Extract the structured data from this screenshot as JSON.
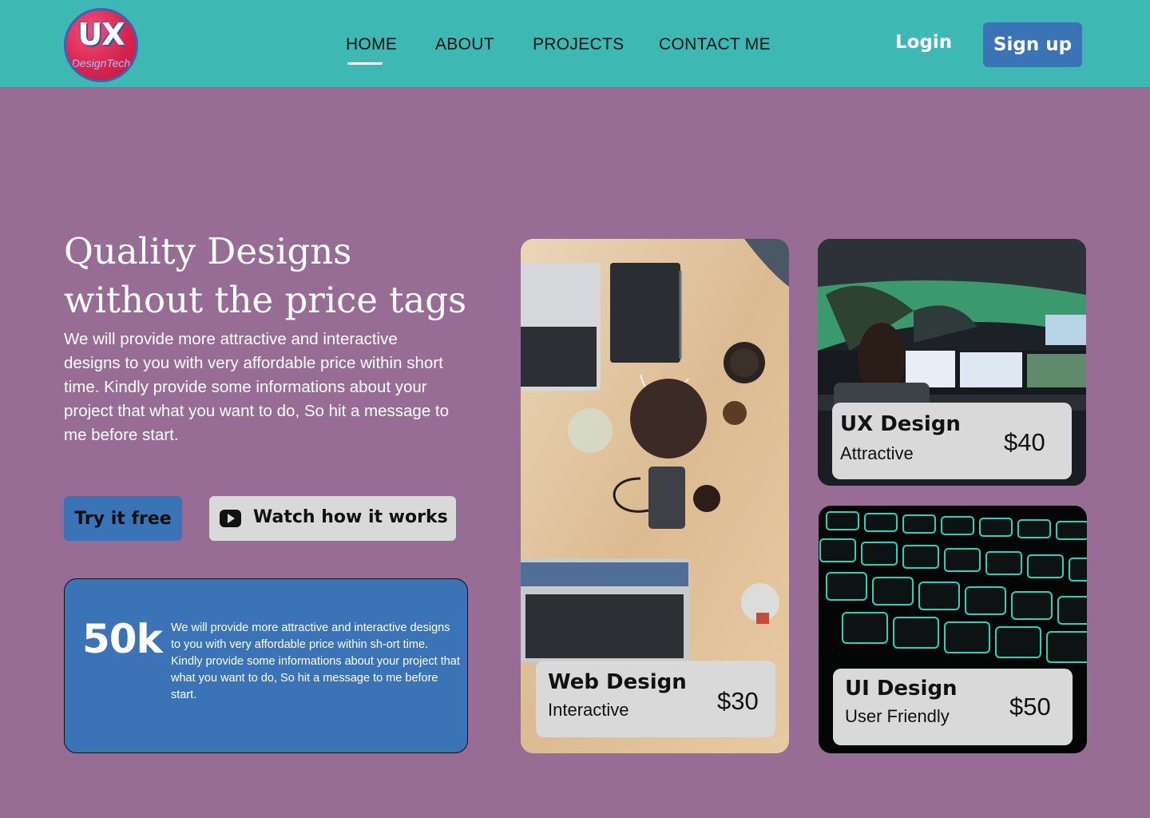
{
  "brand": {
    "logo_main": "UX",
    "logo_sub": "DesignTech"
  },
  "nav": {
    "items": [
      {
        "label": "HOME",
        "active": true
      },
      {
        "label": "ABOUT",
        "active": false
      },
      {
        "label": "PROJECTS",
        "active": false
      },
      {
        "label": "CONTACT ME",
        "active": false
      }
    ],
    "login_label": "Login",
    "signup_label": "Sign up"
  },
  "hero": {
    "title": "Quality Designs without the price tags",
    "description": "We will provide more attractive and interactive designs to you with very affordable price within short time. Kindly provide some informations about your project that what you want to do, So hit a message to me before start.",
    "try_label": "Try it free",
    "watch_label": "Watch how it works",
    "watch_icon": "play-icon"
  },
  "stat": {
    "number": "50k",
    "description": "We will provide more attractive and interactive designs to you with very affordable price within sh-ort time. Kindly provide some informations about your project that what you want to do, So hit a message to me before start."
  },
  "cards": [
    {
      "title": "Web Design",
      "subtitle": "Interactive",
      "price": "$30",
      "image": "desk-with-laptops-photo"
    },
    {
      "title": "UX Design",
      "subtitle": "Attractive",
      "price": "$40",
      "image": "control-room-monitors-photo"
    },
    {
      "title": "UI Design",
      "subtitle": "User Friendly",
      "price": "$50",
      "image": "glowing-keyboard-photo"
    }
  ],
  "colors": {
    "header_bg": "#3db8b2",
    "page_bg": "#976c95",
    "primary_blue": "#3a73b6",
    "light_gray": "#d9d9d9",
    "logo_red": "#d8254f"
  }
}
